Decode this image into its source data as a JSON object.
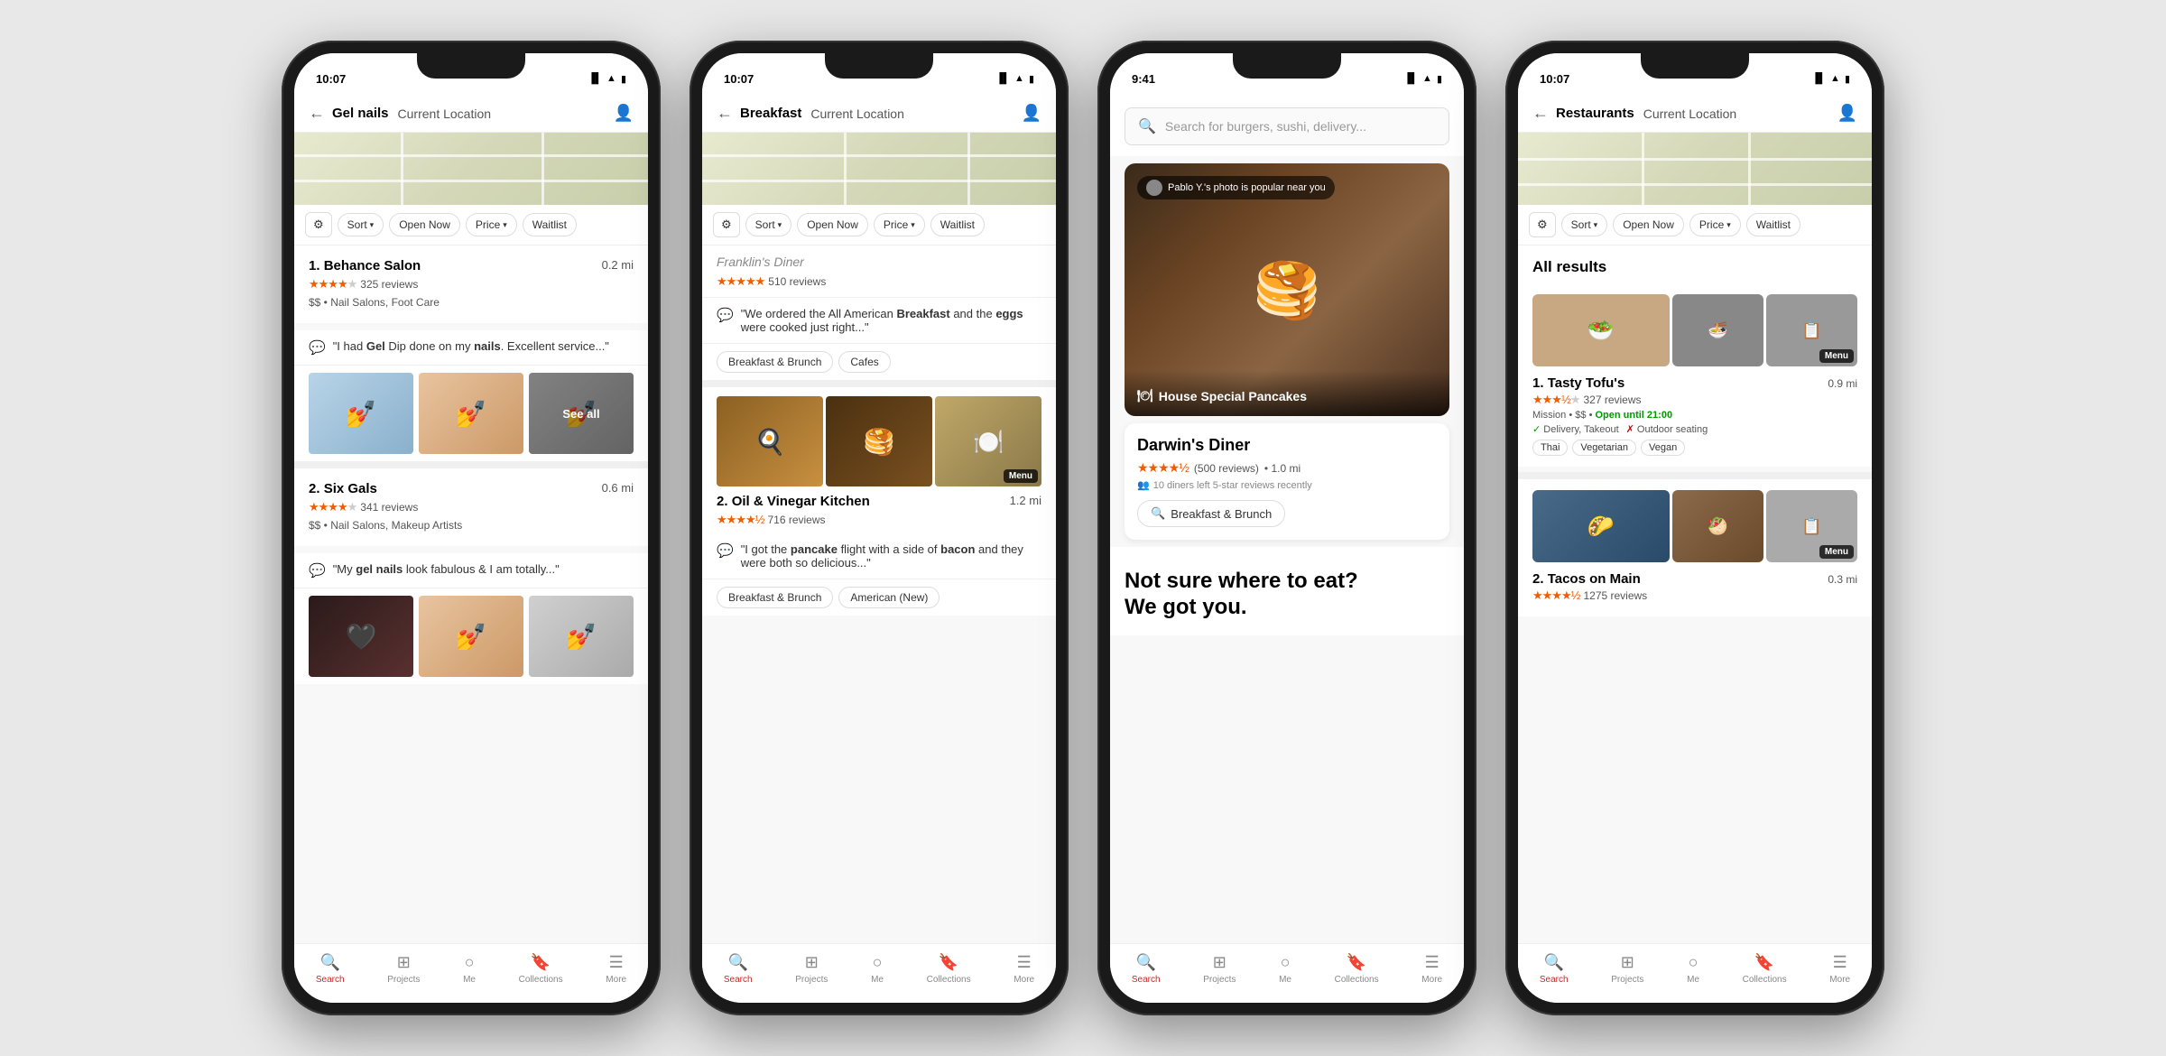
{
  "phones": [
    {
      "id": "phone-gel-nails",
      "time": "10:07",
      "search_query": "Gel nails",
      "search_location": "Current Location",
      "businesses": [
        {
          "rank": "1",
          "name": "Behance Salon",
          "distance": "0.2 mi",
          "stars_full": 4,
          "stars_empty": 1,
          "review_count": "325 reviews",
          "meta": "$$ • Nail Salons, Foot Care",
          "review": "\"I had Gel Dip done on my nails. Excellent service...\"",
          "review_bold": [
            "Gel",
            "nails"
          ]
        },
        {
          "rank": "2",
          "name": "Six Gals",
          "distance": "0.6 mi",
          "stars_full": 4,
          "stars_empty": 1,
          "review_count": "341 reviews",
          "meta": "$$ • Nail Salons, Makeup Artists",
          "review": "\"My gel nails look fabulous & I am totally...\"",
          "review_bold": [
            "gel",
            "nails"
          ]
        }
      ],
      "nav": [
        "Search",
        "Projects",
        "Me",
        "Collections",
        "More"
      ]
    },
    {
      "id": "phone-breakfast",
      "time": "10:07",
      "search_query": "Breakfast",
      "search_location": "Current Location",
      "partial_name": "Franklin's Diner",
      "partial_reviews": "510 reviews",
      "partial_stars": 5,
      "partial_review": "\"We ordered the All American Breakfast and the eggs were cooked just right...\"",
      "partial_review_bold": [
        "Breakfast",
        "eggs"
      ],
      "partial_tags": [
        "Breakfast & Brunch",
        "Cafes"
      ],
      "businesses": [
        {
          "rank": "2",
          "name": "Oil & Vinegar Kitchen",
          "distance": "1.2 mi",
          "stars_full": 4,
          "stars_half": true,
          "stars_empty": 0,
          "review_count": "716 reviews",
          "review": "\"I got the pancake flight with a side of bacon and they were both so delicious...\"",
          "review_bold": [
            "pancake",
            "bacon"
          ],
          "tags": [
            "Breakfast & Brunch",
            "American (New)"
          ]
        }
      ],
      "nav": [
        "Search",
        "Projects",
        "Me",
        "Collections",
        "More"
      ]
    },
    {
      "id": "phone-search-home",
      "time": "9:41",
      "search_placeholder": "Search for burgers, sushi, delivery...",
      "feature_badge": "Pablo Y.'s photo is popular near you",
      "feature_caption": "House Special Pancakes",
      "diner_name": "Darwin's Diner",
      "diner_rating": "4.5",
      "diner_reviews": "500 reviews",
      "diner_distance": "1.0 mi",
      "diner_activity": "10 diners left 5-star reviews recently",
      "diner_category": "Breakfast & Brunch",
      "not_sure_title": "Not sure where to eat?\nWe got you.",
      "nav": [
        "Search",
        "Projects",
        "Me",
        "Collections",
        "More"
      ]
    },
    {
      "id": "phone-restaurants",
      "time": "10:07",
      "search_query": "Restaurants",
      "search_location": "Current Location",
      "all_results_label": "All results",
      "restaurants": [
        {
          "rank": "1",
          "name": "Tasty Tofu's",
          "distance": "0.9 mi",
          "stars_full": 3,
          "stars_half": true,
          "stars_empty": 1,
          "review_count": "327 reviews",
          "location": "Mission",
          "price": "$$",
          "open": "Open until 21:00",
          "attrs": [
            "Delivery, Takeout",
            "Outdoor seating"
          ],
          "tags": [
            "Thai",
            "Vegetarian",
            "Vegan"
          ]
        },
        {
          "rank": "2",
          "name": "Tacos on Main",
          "distance": "0.3 mi",
          "stars_full": 4,
          "stars_half": true,
          "stars_empty": 0,
          "review_count": "1275 reviews"
        }
      ],
      "nav": [
        "Search",
        "Projects",
        "Me",
        "Collections",
        "More"
      ]
    }
  ],
  "labels": {
    "sort": "Sort",
    "open_now": "Open Now",
    "price": "Price",
    "waitlist": "Waitlist",
    "see_all": "See all",
    "menu": "Menu",
    "back": "←",
    "search_nav": "Search",
    "projects_nav": "Projects",
    "me_nav": "Me",
    "collections_nav": "Collections",
    "more_nav": "More"
  }
}
